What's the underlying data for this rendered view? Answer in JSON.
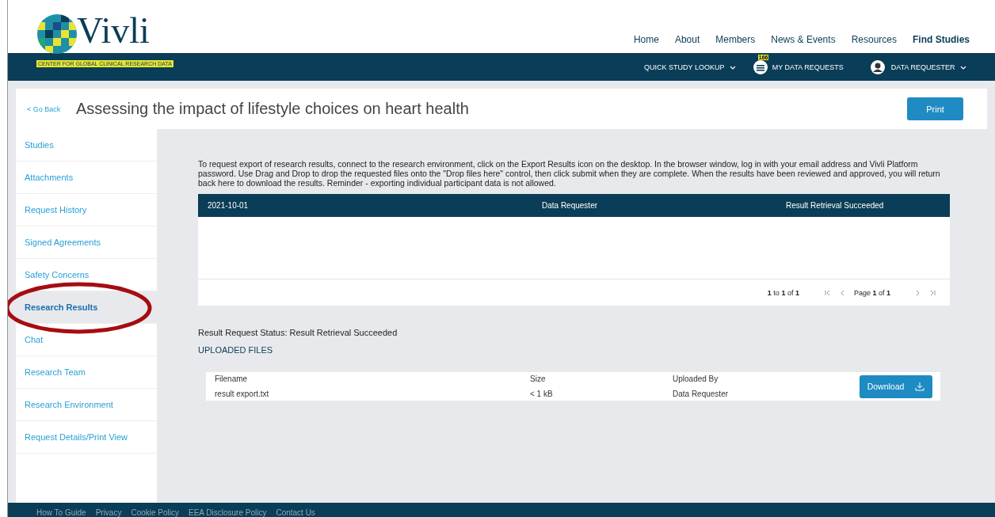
{
  "logo": {
    "name": "Vivli",
    "tagline": "CENTER FOR GLOBAL CLINICAL RESEARCH DATA"
  },
  "top_nav": [
    {
      "label": "Home",
      "selected": false
    },
    {
      "label": "About",
      "selected": false
    },
    {
      "label": "Members",
      "selected": false
    },
    {
      "label": "News & Events",
      "selected": false
    },
    {
      "label": "Resources",
      "selected": false
    },
    {
      "label": "Find Studies",
      "selected": true
    }
  ],
  "sub_nav": {
    "lookup": "QUICK STUDY LOOKUP",
    "requests": "MY DATA REQUESTS",
    "requests_badge": "166",
    "user": "DATA REQUESTER"
  },
  "page": {
    "back": "< Go Back",
    "title": "Assessing the impact of lifestyle choices on heart health",
    "print": "Print"
  },
  "sidebar": [
    {
      "label": "Studies",
      "selected": false
    },
    {
      "label": "Attachments",
      "selected": false
    },
    {
      "label": "Request History",
      "selected": false
    },
    {
      "label": "Signed Agreements",
      "selected": false
    },
    {
      "label": "Safety Concerns",
      "selected": false
    },
    {
      "label": "Research Results",
      "selected": true,
      "circled": true
    },
    {
      "label": "Chat",
      "selected": false
    },
    {
      "label": "Research Team",
      "selected": false
    },
    {
      "label": "Research Environment",
      "selected": false
    },
    {
      "label": "Request Details/Print View",
      "selected": false
    }
  ],
  "instructions": "To request export of research results, connect to the research environment, click on the Export Results icon on the desktop. In the browser window, log in with your email address and Vivli Platform password. Use Drag and Drop to drop the requested files onto the \"Drop files here\" control, then click submit when they are complete. When the results have been reviewed and approved, you will return back here to download the results. Reminder - exporting individual participant data is not allowed.",
  "results_table": {
    "header": [
      "2021-10-01",
      "Data Requester",
      "Result Retrieval Succeeded"
    ],
    "range": "**1** to **1** of **1**",
    "page": "Page **1** of **1**"
  },
  "status": "Result Request Status: Result Retrieval Succeeded",
  "uploaded_heading": "UPLOADED FILES",
  "files": {
    "columns": [
      "Filename",
      "Size",
      "Uploaded By"
    ],
    "rows": [
      [
        "result export.txt",
        "< 1 kB",
        "Data Requester"
      ]
    ],
    "download": "Download"
  },
  "footer": [
    "How To Guide",
    "Privacy",
    "Cookie Policy",
    "EEA Disclosure Policy",
    "Contact Us"
  ]
}
